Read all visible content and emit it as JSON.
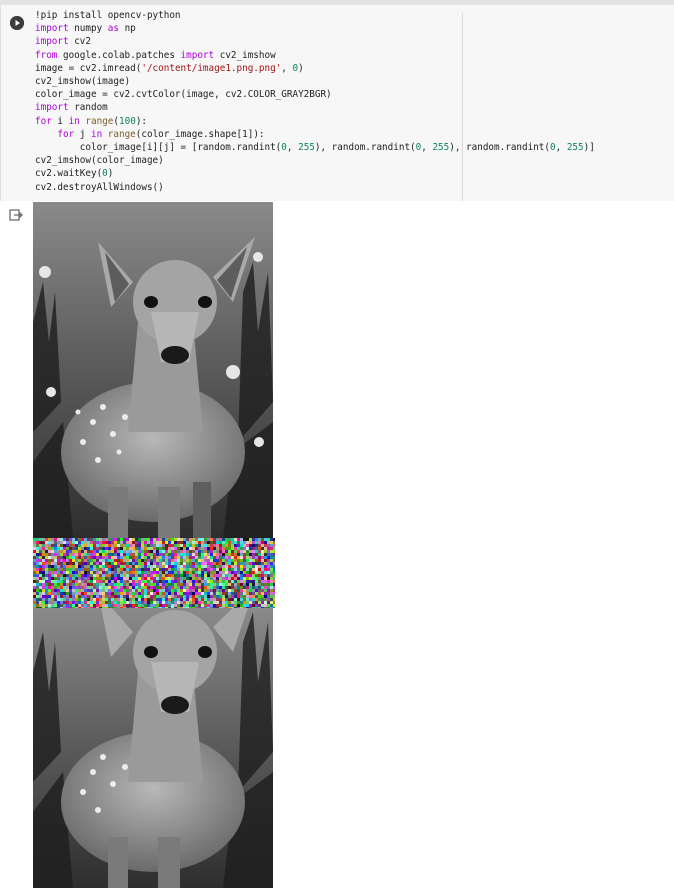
{
  "cell": {
    "code_lines": [
      "!pip install opencv-python",
      "import numpy as np",
      "import cv2",
      "from google.colab.patches import cv2_imshow",
      "image = cv2.imread('/content/image1.png.png', 0)",
      "cv2_imshow(image)",
      "color_image = cv2.cvtColor(image, cv2.COLOR_GRAY2BGR)",
      "import random",
      "for i in range(100):",
      "    for j in range(color_image.shape[1]):",
      "        color_image[i][j] = [random.randint(0, 255), random.randint(0, 255), random.randint(0, 255)]",
      "cv2_imshow(color_image)",
      "cv2.waitKey(0)",
      "cv2.destroyAllWindows()"
    ]
  },
  "icons": {
    "run": "play-circle-icon",
    "output": "output-redirect-icon"
  },
  "outputs": [
    {
      "kind": "image",
      "description_name": "grayscale-deer-image"
    },
    {
      "kind": "image",
      "description_name": "random-color-noise-band"
    },
    {
      "kind": "image",
      "description_name": "grayscale-deer-image-cropped"
    }
  ],
  "colors": {
    "keyword": "#af00db",
    "string": "#a31515",
    "number": "#098658",
    "function": "#795e26",
    "cell_bg": "#f7f7f7"
  }
}
